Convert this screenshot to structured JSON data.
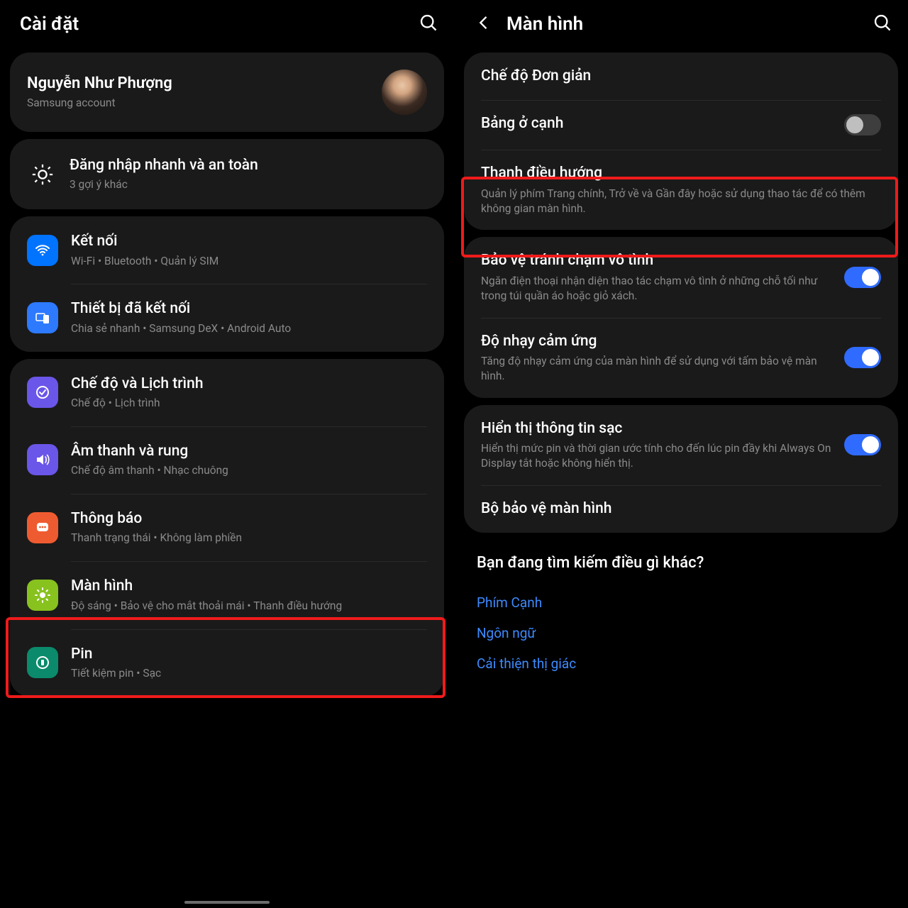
{
  "left": {
    "title": "Cài đặt",
    "account": {
      "name": "Nguyễn Như Phượng",
      "sub": "Samsung account"
    },
    "tip": {
      "title": "Đăng nhập nhanh và an toàn",
      "sub": "3 gợi ý khác"
    },
    "items": {
      "connections": {
        "title": "Kết nối",
        "sub": "Wi-Fi  •  Bluetooth  •  Quản lý SIM"
      },
      "devices": {
        "title": "Thiết bị đã kết nối",
        "sub": "Chia sẻ nhanh  •  Samsung DeX  •  Android Auto"
      },
      "modes": {
        "title": "Chế độ và Lịch trình",
        "sub": "Chế độ  •  Lịch trình"
      },
      "sound": {
        "title": "Âm thanh và rung",
        "sub": "Chế độ âm thanh  •  Nhạc chuông"
      },
      "notif": {
        "title": "Thông báo",
        "sub": "Thanh trạng thái  •  Không làm phiền"
      },
      "display": {
        "title": "Màn hình",
        "sub": "Độ sáng  •  Bảo vệ cho mắt thoải mái  •  Thanh điều hướng"
      },
      "battery": {
        "title": "Pin",
        "sub": "Tiết kiệm pin  •  Sạc"
      }
    }
  },
  "right": {
    "title": "Màn hình",
    "group1": {
      "simple": {
        "title": "Chế độ Đơn giản"
      },
      "edge": {
        "title": "Bảng ở cạnh"
      },
      "nav": {
        "title": "Thanh điều hướng",
        "sub": "Quản lý phím Trang chính, Trở về và Gần đây hoặc sử dụng thao tác để có thêm không gian màn hình."
      }
    },
    "group2": {
      "protect": {
        "title": "Bảo vệ tránh chạm vô tình",
        "sub": "Ngăn điện thoại nhận diện thao tác chạm vô tình ở những chỗ tối như trong túi quần áo hoặc giỏ xách."
      },
      "sens": {
        "title": "Độ nhạy cảm ứng",
        "sub": "Tăng độ nhạy cảm ứng của màn hình để sử dụng với tấm bảo vệ màn hình."
      }
    },
    "group3": {
      "charge": {
        "title": "Hiển thị thông tin sạc",
        "sub": "Hiển thị mức pin và thời gian ước tính cho đến lúc pin đầy khi Always On Display tắt hoặc không hiển thị."
      },
      "saver": {
        "title": "Bộ bảo vệ màn hình"
      }
    },
    "more": {
      "heading": "Bạn đang tìm kiếm điều gì khác?",
      "links": [
        "Phím Cạnh",
        "Ngôn ngữ",
        "Cải thiện thị giác"
      ]
    }
  }
}
